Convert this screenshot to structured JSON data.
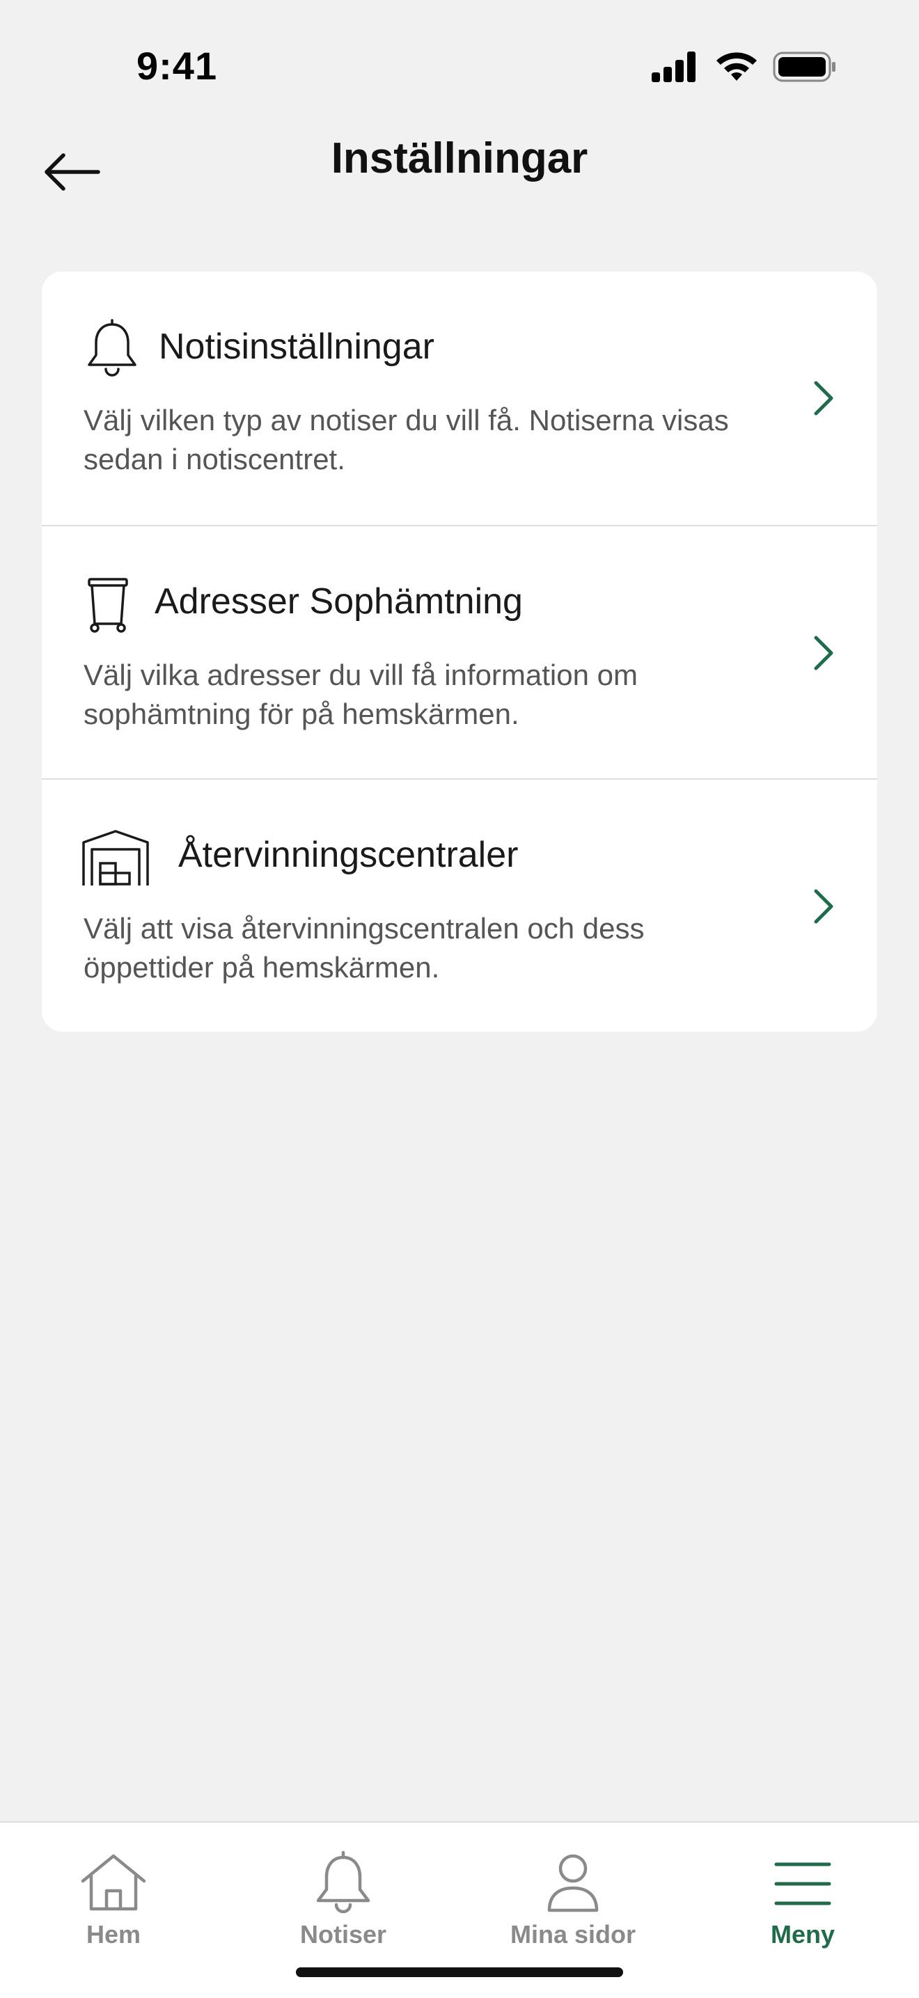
{
  "status_bar": {
    "time": "9:41",
    "icons": [
      "cellular-signal-icon",
      "wifi-icon",
      "battery-icon"
    ]
  },
  "header": {
    "title": "Inställningar",
    "back_icon": "arrow-left-icon"
  },
  "settings": {
    "items": [
      {
        "icon": "bell-icon",
        "title": "Notisinställningar",
        "description": "Välj vilken typ av notiser du vill få. Notiserna visas sedan i notiscentret."
      },
      {
        "icon": "trash-bin-icon",
        "title": "Adresser Sophämtning",
        "description": "Välj vilka adresser du vill få information om sophämtning för på hemskärmen."
      },
      {
        "icon": "recycling-center-icon",
        "title": "Återvinningscentraler",
        "description": "Välj att visa återvinningscentralen och dess öppettider på hemskärmen."
      }
    ]
  },
  "tab_bar": {
    "tabs": [
      {
        "icon": "home-icon",
        "label": "Hem",
        "active": false
      },
      {
        "icon": "bell-icon",
        "label": "Notiser",
        "active": false
      },
      {
        "icon": "person-icon",
        "label": "Mina sidor",
        "active": false
      },
      {
        "icon": "menu-icon",
        "label": "Meny",
        "active": true
      }
    ]
  },
  "colors": {
    "background": "#f1f1f1",
    "card": "#ffffff",
    "accent": "#1f6b4a",
    "inactive_tab": "#8a8a8a",
    "title": "#111111",
    "description": "#555555"
  }
}
